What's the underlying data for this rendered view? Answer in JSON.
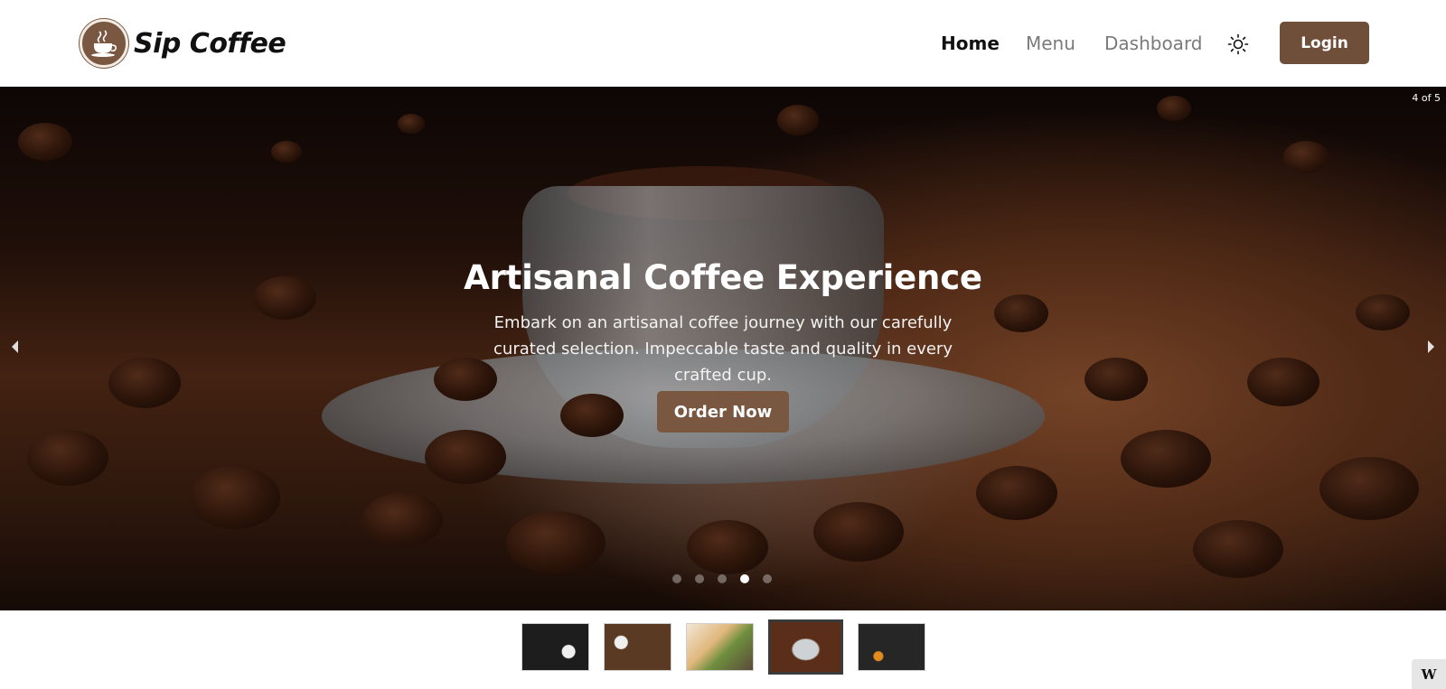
{
  "header": {
    "brand_name": "Sip Coffee",
    "nav": {
      "home": "Home",
      "menu": "Menu",
      "dashboard": "Dashboard"
    },
    "theme_icon": "sun-icon",
    "login_label": "Login"
  },
  "hero": {
    "slide_counter": "4 of 5",
    "title": "Artisanal Coffee Experience",
    "text": "Embark on an artisanal coffee journey with our carefully curated selection. Impeccable taste and quality in every crafted cup.",
    "cta_label": "Order Now",
    "current_slide": 4,
    "total_slides": 5
  },
  "thumbnails": {
    "count": 5,
    "active_index": 4
  },
  "colors": {
    "accent": "#7a5741",
    "login_bg": "#6f4e3a",
    "nav_active": "#111111",
    "nav_inactive": "#7a7a7a"
  },
  "badge": "W"
}
